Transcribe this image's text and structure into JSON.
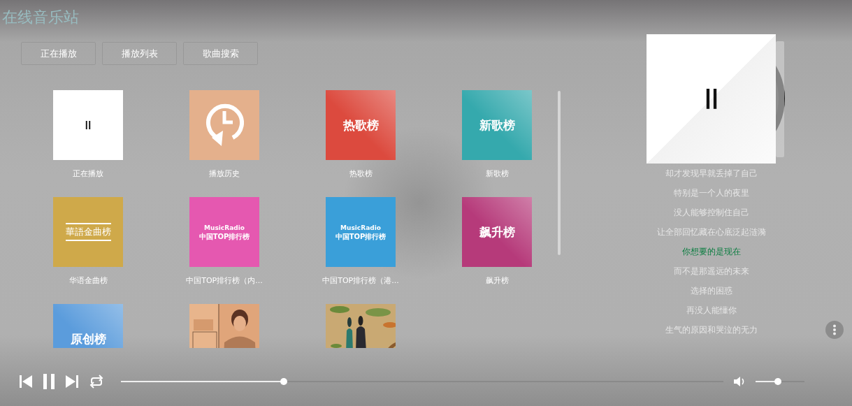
{
  "app": {
    "title": "在线音乐站"
  },
  "tabs": [
    {
      "label": "正在播放",
      "selected": false
    },
    {
      "label": "播放列表",
      "selected": false
    },
    {
      "label": "歌曲搜索",
      "selected": false
    }
  ],
  "playlists": [
    {
      "label": "正在播放",
      "cover": {
        "kind": "pause"
      }
    },
    {
      "label": "播放历史",
      "cover": {
        "kind": "history",
        "color": "#e4b08c"
      }
    },
    {
      "label": "热歌榜",
      "cover": {
        "kind": "badge",
        "color": "#dc4a3e",
        "text": "热歌榜"
      }
    },
    {
      "label": "新歌榜",
      "cover": {
        "kind": "badge",
        "color": "#35a9ad",
        "text": "新歌榜"
      }
    },
    {
      "label": "华语金曲榜",
      "cover": {
        "kind": "award",
        "color": "#cfa94a",
        "text": "華語金曲榜"
      }
    },
    {
      "label": "中国TOP排行榜（内...",
      "cover": {
        "kind": "radio",
        "color": "#e558b0",
        "lines": [
          "MusicRadio",
          "中国TOP排行榜"
        ]
      }
    },
    {
      "label": "中国TOP排行榜（港...",
      "cover": {
        "kind": "radio",
        "color": "#3a9fd9",
        "lines": [
          "MusicRadio",
          "中国TOP排行榜"
        ]
      }
    },
    {
      "label": "飙升榜",
      "cover": {
        "kind": "badge",
        "color": "#b63a7a",
        "text": "飙升榜"
      }
    },
    {
      "cover": {
        "kind": "badge",
        "color": "#5b9cdc",
        "text": "原创榜"
      }
    },
    {
      "cover": {
        "kind": "picture"
      }
    },
    {
      "cover": {
        "kind": "picture"
      }
    }
  ],
  "player": {
    "playing": true,
    "lyrics": [
      {
        "text": "却才发现早就丢掉了自己",
        "current": false
      },
      {
        "text": "特别是一个人的夜里",
        "current": false
      },
      {
        "text": "没人能够控制住自己",
        "current": false
      },
      {
        "text": "让全部回忆藏在心底泛起涟漪",
        "current": false
      },
      {
        "text": "你想要的是现在",
        "current": true
      },
      {
        "text": "而不是那遥远的未来",
        "current": false
      },
      {
        "text": "选择的困惑",
        "current": false
      },
      {
        "text": "再没人能懂你",
        "current": false
      },
      {
        "text": "生气的原因和哭泣的无力",
        "current": false
      }
    ],
    "progress": {
      "level": 0.27
    },
    "volume": {
      "level": 0.45
    }
  }
}
